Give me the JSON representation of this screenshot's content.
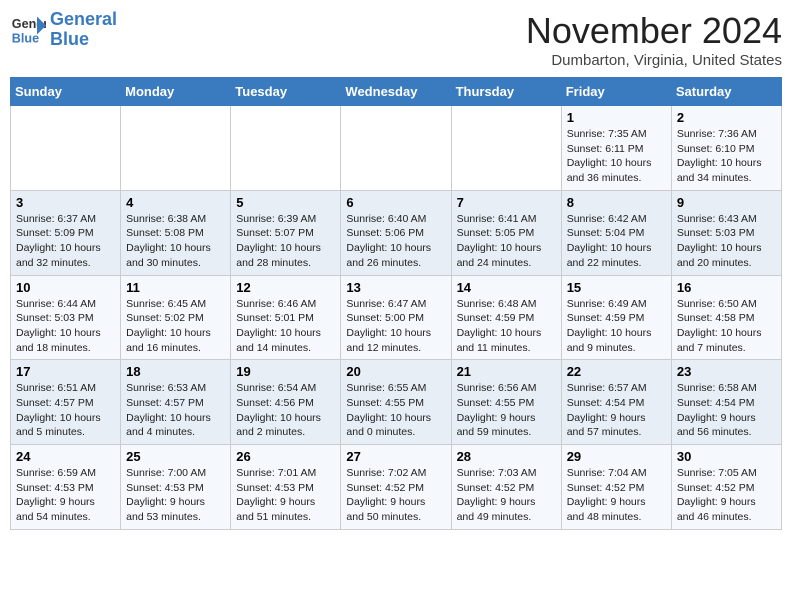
{
  "header": {
    "logo_line1": "General",
    "logo_line2": "Blue",
    "month": "November 2024",
    "location": "Dumbarton, Virginia, United States"
  },
  "weekdays": [
    "Sunday",
    "Monday",
    "Tuesday",
    "Wednesday",
    "Thursday",
    "Friday",
    "Saturday"
  ],
  "weeks": [
    [
      {
        "day": "",
        "info": ""
      },
      {
        "day": "",
        "info": ""
      },
      {
        "day": "",
        "info": ""
      },
      {
        "day": "",
        "info": ""
      },
      {
        "day": "",
        "info": ""
      },
      {
        "day": "1",
        "info": "Sunrise: 7:35 AM\nSunset: 6:11 PM\nDaylight: 10 hours\nand 36 minutes."
      },
      {
        "day": "2",
        "info": "Sunrise: 7:36 AM\nSunset: 6:10 PM\nDaylight: 10 hours\nand 34 minutes."
      }
    ],
    [
      {
        "day": "3",
        "info": "Sunrise: 6:37 AM\nSunset: 5:09 PM\nDaylight: 10 hours\nand 32 minutes."
      },
      {
        "day": "4",
        "info": "Sunrise: 6:38 AM\nSunset: 5:08 PM\nDaylight: 10 hours\nand 30 minutes."
      },
      {
        "day": "5",
        "info": "Sunrise: 6:39 AM\nSunset: 5:07 PM\nDaylight: 10 hours\nand 28 minutes."
      },
      {
        "day": "6",
        "info": "Sunrise: 6:40 AM\nSunset: 5:06 PM\nDaylight: 10 hours\nand 26 minutes."
      },
      {
        "day": "7",
        "info": "Sunrise: 6:41 AM\nSunset: 5:05 PM\nDaylight: 10 hours\nand 24 minutes."
      },
      {
        "day": "8",
        "info": "Sunrise: 6:42 AM\nSunset: 5:04 PM\nDaylight: 10 hours\nand 22 minutes."
      },
      {
        "day": "9",
        "info": "Sunrise: 6:43 AM\nSunset: 5:03 PM\nDaylight: 10 hours\nand 20 minutes."
      }
    ],
    [
      {
        "day": "10",
        "info": "Sunrise: 6:44 AM\nSunset: 5:03 PM\nDaylight: 10 hours\nand 18 minutes."
      },
      {
        "day": "11",
        "info": "Sunrise: 6:45 AM\nSunset: 5:02 PM\nDaylight: 10 hours\nand 16 minutes."
      },
      {
        "day": "12",
        "info": "Sunrise: 6:46 AM\nSunset: 5:01 PM\nDaylight: 10 hours\nand 14 minutes."
      },
      {
        "day": "13",
        "info": "Sunrise: 6:47 AM\nSunset: 5:00 PM\nDaylight: 10 hours\nand 12 minutes."
      },
      {
        "day": "14",
        "info": "Sunrise: 6:48 AM\nSunset: 4:59 PM\nDaylight: 10 hours\nand 11 minutes."
      },
      {
        "day": "15",
        "info": "Sunrise: 6:49 AM\nSunset: 4:59 PM\nDaylight: 10 hours\nand 9 minutes."
      },
      {
        "day": "16",
        "info": "Sunrise: 6:50 AM\nSunset: 4:58 PM\nDaylight: 10 hours\nand 7 minutes."
      }
    ],
    [
      {
        "day": "17",
        "info": "Sunrise: 6:51 AM\nSunset: 4:57 PM\nDaylight: 10 hours\nand 5 minutes."
      },
      {
        "day": "18",
        "info": "Sunrise: 6:53 AM\nSunset: 4:57 PM\nDaylight: 10 hours\nand 4 minutes."
      },
      {
        "day": "19",
        "info": "Sunrise: 6:54 AM\nSunset: 4:56 PM\nDaylight: 10 hours\nand 2 minutes."
      },
      {
        "day": "20",
        "info": "Sunrise: 6:55 AM\nSunset: 4:55 PM\nDaylight: 10 hours\nand 0 minutes."
      },
      {
        "day": "21",
        "info": "Sunrise: 6:56 AM\nSunset: 4:55 PM\nDaylight: 9 hours\nand 59 minutes."
      },
      {
        "day": "22",
        "info": "Sunrise: 6:57 AM\nSunset: 4:54 PM\nDaylight: 9 hours\nand 57 minutes."
      },
      {
        "day": "23",
        "info": "Sunrise: 6:58 AM\nSunset: 4:54 PM\nDaylight: 9 hours\nand 56 minutes."
      }
    ],
    [
      {
        "day": "24",
        "info": "Sunrise: 6:59 AM\nSunset: 4:53 PM\nDaylight: 9 hours\nand 54 minutes."
      },
      {
        "day": "25",
        "info": "Sunrise: 7:00 AM\nSunset: 4:53 PM\nDaylight: 9 hours\nand 53 minutes."
      },
      {
        "day": "26",
        "info": "Sunrise: 7:01 AM\nSunset: 4:53 PM\nDaylight: 9 hours\nand 51 minutes."
      },
      {
        "day": "27",
        "info": "Sunrise: 7:02 AM\nSunset: 4:52 PM\nDaylight: 9 hours\nand 50 minutes."
      },
      {
        "day": "28",
        "info": "Sunrise: 7:03 AM\nSunset: 4:52 PM\nDaylight: 9 hours\nand 49 minutes."
      },
      {
        "day": "29",
        "info": "Sunrise: 7:04 AM\nSunset: 4:52 PM\nDaylight: 9 hours\nand 48 minutes."
      },
      {
        "day": "30",
        "info": "Sunrise: 7:05 AM\nSunset: 4:52 PM\nDaylight: 9 hours\nand 46 minutes."
      }
    ]
  ]
}
